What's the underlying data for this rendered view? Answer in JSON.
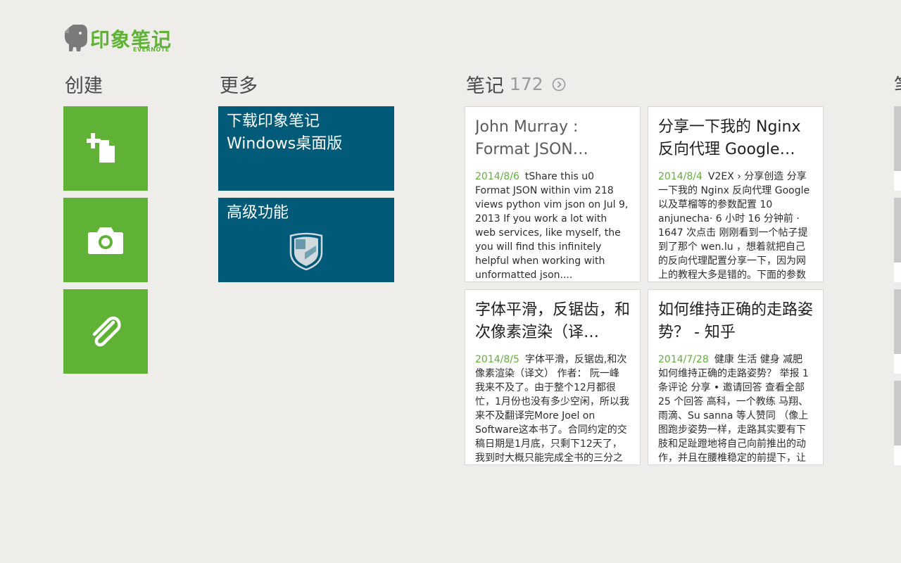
{
  "app": {
    "logo_text": "印象笔记",
    "logo_sub": "EVERNOTE"
  },
  "create": {
    "title": "创建",
    "tiles": [
      {
        "icon": "new-note-icon"
      },
      {
        "icon": "camera-icon"
      },
      {
        "icon": "paperclip-icon"
      }
    ]
  },
  "more": {
    "title": "更多",
    "tiles": [
      {
        "label": "下载印象笔记\nWindows桌面版"
      },
      {
        "label": "高级功能",
        "icon": "premium-shield-icon"
      }
    ]
  },
  "notes": {
    "title": "笔记",
    "count": "172",
    "next_partial_title": "笔",
    "items": [
      {
        "title": "John Murray : Format JSON…",
        "date": "2014/8/6",
        "snippet": "tShare this u0 Format JSON within vim  218 views python vim json  on Jul 9, 2013 If you work a lot with web services, like myself, the you will find this infinitely helpful when working with unformatted json...."
      },
      {
        "title": "分享一下我的 Nginx 反向代理 Google…",
        "date": "2014/8/4",
        "snippet": "V2EX › 分享创造 分享一下我的 Nginx 反向代理 Google 以及草榴等的参数配置  10  anjunecha· 6 小时 16 分钟前 · 1647 次点击 刚刚看到一个帖子提到了那个 wen.lu ，想着就把自己的反向代理配置分享一下，因为网上的教程大多是错的。下面的参数"
      },
      {
        "title": "字体平滑，反锯齿，和次像素渲染（译…",
        "date": "2014/8/5",
        "snippet": "字体平滑，反锯齿,和次像素渲染（译文） 作者： 阮一峰 我来不及了。由于整个12月都很忙，1月份也没有多少空闲，所以我来不及翻译完More Joel on Software这本书了。合同约定的交稿日期是1月底，只剩下12天了，我到时大概只能完成全书的三分之"
      },
      {
        "title": "如何维持正确的走路姿势？ - 知乎",
        "date": "2014/7/28",
        "snippet": "健康 生活 健身 减肥 如何维持正确的走路姿势？ 举报 1 条评论 分享 • 邀请回答 查看全部 25 个回答 高科，一个教练 马翔、雨滴、Su sanna 等人赞同 （像上图跑步姿势一样，走路其实要有下肢和足趾蹬地将自己向前推出的动作，并且在腰椎稳定的前提下，让"
      }
    ]
  },
  "colors": {
    "green": "#5fb236",
    "blue": "#005a78",
    "background": "#eeedea"
  }
}
